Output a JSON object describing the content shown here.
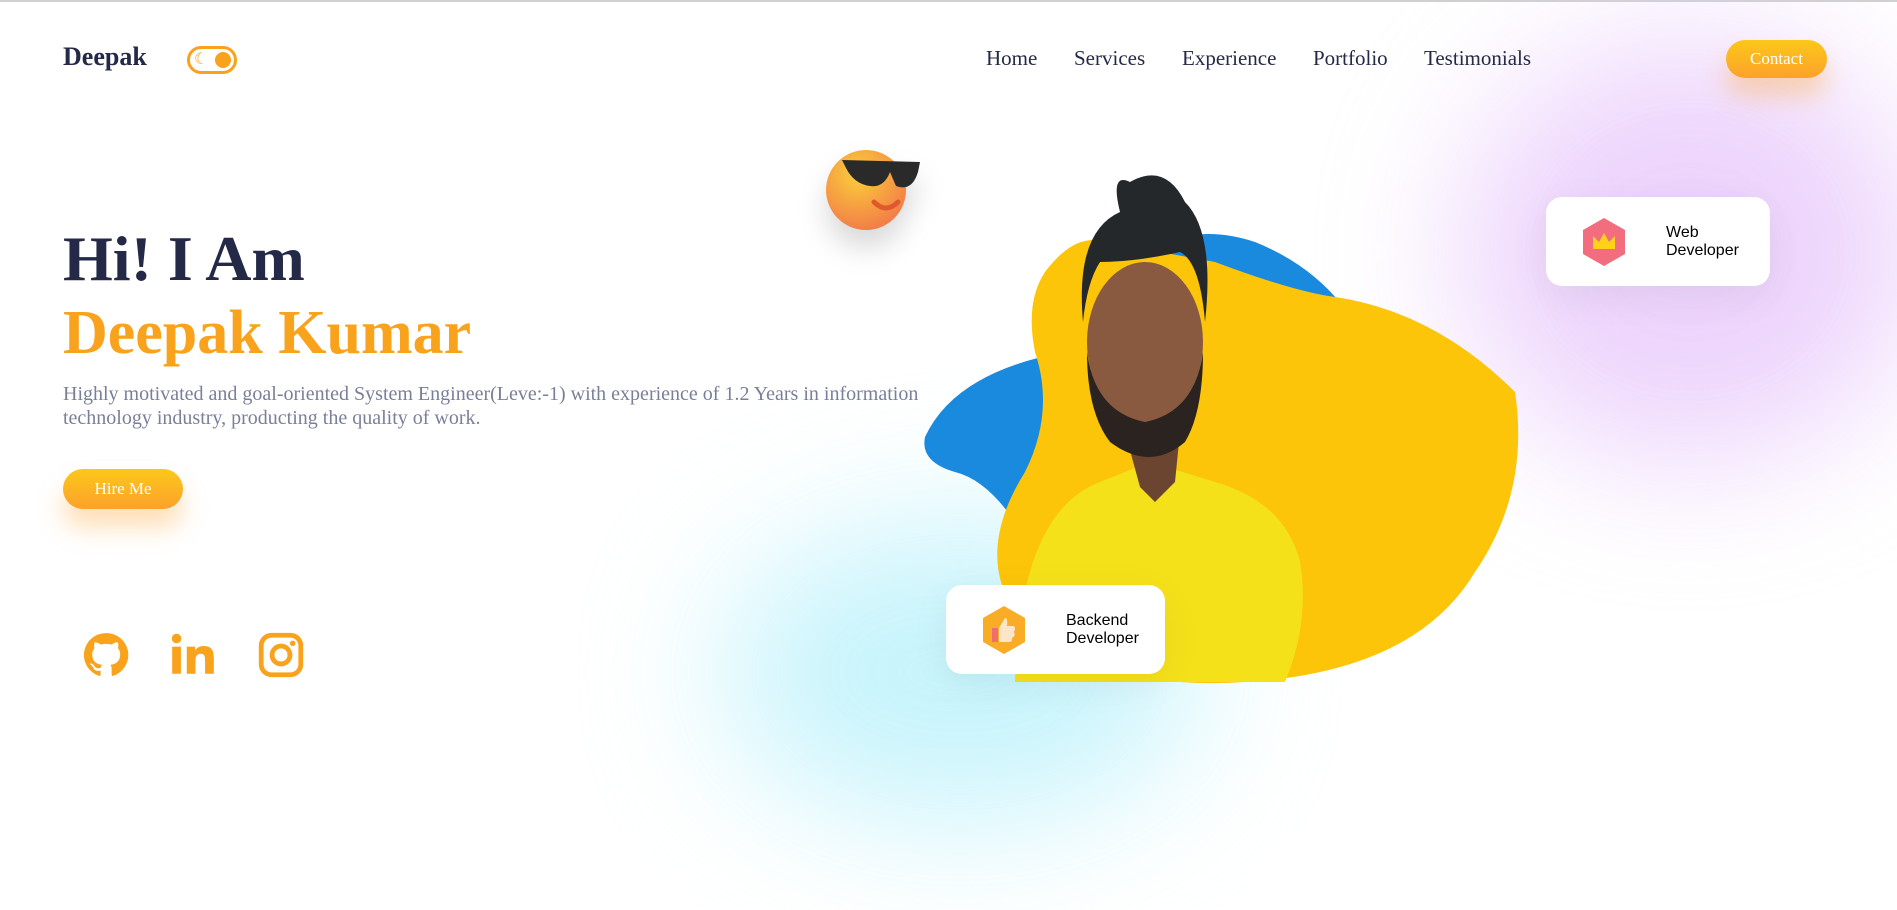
{
  "header": {
    "logo": "Deepak",
    "theme_toggle_icon": "moon-icon",
    "nav": [
      "Home",
      "Services",
      "Experience",
      "Portfolio",
      "Testimonials"
    ],
    "contact_label": "Contact"
  },
  "hero": {
    "greeting": "Hi! I Am",
    "name": "Deepak Kumar",
    "description": "Highly motivated and goal-oriented System Engineer(Leve:-1) with experience of 1.2 Years in information technology industry, producting the quality of work.",
    "hire_label": "Hire Me",
    "social": [
      "github-icon",
      "linkedin-icon",
      "instagram-icon"
    ]
  },
  "cards": {
    "web": [
      "Web",
      "Developer"
    ],
    "backend": [
      "Backend",
      "Developer"
    ]
  },
  "colors": {
    "accent": "#f9a21b",
    "navy": "#232946",
    "blue_blob": "#1a8adf",
    "yellow_blob": "#fcc509"
  }
}
